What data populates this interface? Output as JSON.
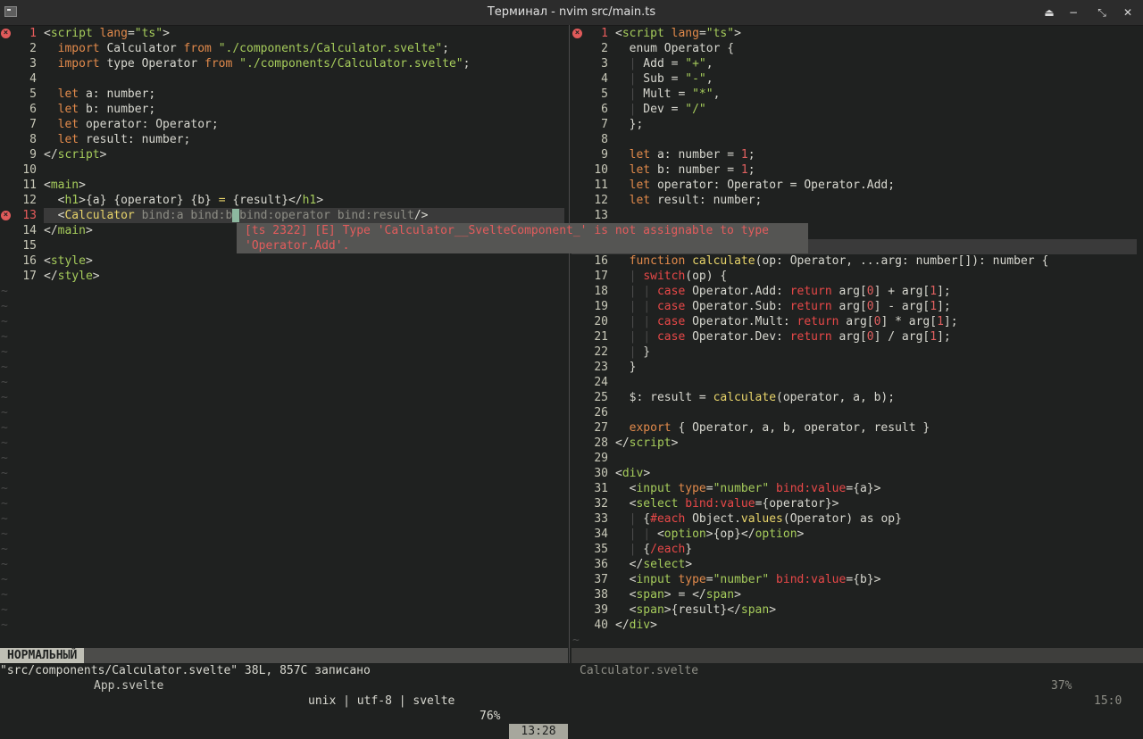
{
  "window": {
    "title": "Терминал - nvim src/main.ts",
    "buttons": [
      "keep-above",
      "minimize",
      "maximize",
      "close"
    ]
  },
  "left": {
    "filename": "App.svelte",
    "lines": [
      {
        "n": "1",
        "error": true,
        "html": "&lt;<span class='tag'>script</span><span class='k'> lang</span>=<span class='s'>\"ts\"</span>&gt;"
      },
      {
        "n": "2",
        "html": "  <span class='k'>import</span> Calculator <span class='k'>from</span> <span class='s'>\"./components/Calculator.svelte\"</span>;"
      },
      {
        "n": "3",
        "html": "  <span class='k'>import</span> type Operator <span class='k'>from</span> <span class='s'>\"./components/Calculator.svelte\"</span>;"
      },
      {
        "n": "4",
        "html": ""
      },
      {
        "n": "5",
        "html": "  <span class='k'>let</span> a: number;"
      },
      {
        "n": "6",
        "html": "  <span class='k'>let</span> b: number;"
      },
      {
        "n": "7",
        "html": "  <span class='k'>let</span> operator: Operator;"
      },
      {
        "n": "8",
        "html": "  <span class='k'>let</span> result: number;"
      },
      {
        "n": "9",
        "html": "&lt;/<span class='tag'>script</span>&gt;"
      },
      {
        "n": "10",
        "html": ""
      },
      {
        "n": "11",
        "html": "&lt;<span class='tag'>main</span>&gt;"
      },
      {
        "n": "12",
        "html": "  &lt;<span class='tag'>h1</span>&gt;{a} {operator} {b} <span class='fn'>=</span> {result}&lt;/<span class='tag'>h1</span>&gt;"
      },
      {
        "n": "13",
        "error": true,
        "cursorline": true,
        "html": "  &lt;<span class='fn'>Calculator</span><span class='dim'> bind:a bind:b</span><span style='background:#8db8a0;color:#1f2120'> </span><span class='dim'>bind:operator bind:result</span>/&gt;"
      },
      {
        "n": "14",
        "html": "&lt;/<span class='tag'>main</span>&gt;"
      },
      {
        "n": "15",
        "html": ""
      },
      {
        "n": "16",
        "html": "&lt;<span class='tag'>style</span>&gt;"
      },
      {
        "n": "17",
        "html": "&lt;/<span class='tag'>style</span>&gt;"
      }
    ],
    "tilde_count": 23,
    "status": {
      "mode": "НОРМАЛЬНЫЙ",
      "filename": "App.svelte",
      "format": "unix | utf-8 | svelte",
      "percent": "76%",
      "position": "13:28"
    }
  },
  "diagnostic": {
    "line1": "[ts 2322] [E] Type 'Calculator__SvelteComponent_' is not assignable to type",
    "line2": "'Operator.Add'."
  },
  "right": {
    "filename": "Calculator.svelte",
    "lines": [
      {
        "n": "1",
        "error": true,
        "html": "&lt;<span class='tag'>script</span><span class='k'> lang</span>=<span class='s'>\"ts\"</span>&gt;"
      },
      {
        "n": "2",
        "html": "  enum Operator {"
      },
      {
        "n": "3",
        "html": "  <span class='tilde'>|</span> Add = <span class='s'>\"+\"</span>,"
      },
      {
        "n": "4",
        "html": "  <span class='tilde'>|</span> Sub = <span class='s'>\"-\"</span>,"
      },
      {
        "n": "5",
        "html": "  <span class='tilde'>|</span> Mult = <span class='s'>\"*\"</span>,"
      },
      {
        "n": "6",
        "html": "  <span class='tilde'>|</span> Dev = <span class='s'>\"/\"</span>"
      },
      {
        "n": "7",
        "html": "  };"
      },
      {
        "n": "8",
        "html": ""
      },
      {
        "n": "9",
        "html": "  <span class='k'>let</span> a: number = <span class='n'>1</span>;"
      },
      {
        "n": "10",
        "html": "  <span class='k'>let</span> b: number = <span class='n'>1</span>;"
      },
      {
        "n": "11",
        "html": "  <span class='k'>let</span> operator: Operator = Operator.Add;"
      },
      {
        "n": "12",
        "html": "  <span class='k'>let</span> result: number;"
      },
      {
        "n": "13",
        "html": ""
      },
      {
        "n": "14",
        "html": ""
      },
      {
        "n": "15",
        "html": ""
      },
      {
        "n": "16",
        "html": "  <span class='k'>function</span> <span class='fn'>calculate</span>(op: Operator, ...arg: number[]): number {"
      },
      {
        "n": "17",
        "html": "  <span class='tilde'>|</span> <span class='bl'>switch</span>(op) {"
      },
      {
        "n": "18",
        "html": "  <span class='tilde'>|</span> <span class='tilde'>|</span> <span class='bl'>case</span> Operator.Add: <span class='bl'>return</span> arg[<span class='n'>0</span>] + arg[<span class='n'>1</span>];"
      },
      {
        "n": "19",
        "html": "  <span class='tilde'>|</span> <span class='tilde'>|</span> <span class='bl'>case</span> Operator.Sub: <span class='bl'>return</span> arg[<span class='n'>0</span>] - arg[<span class='n'>1</span>];"
      },
      {
        "n": "20",
        "html": "  <span class='tilde'>|</span> <span class='tilde'>|</span> <span class='bl'>case</span> Operator.Mult: <span class='bl'>return</span> arg[<span class='n'>0</span>] * arg[<span class='n'>1</span>];"
      },
      {
        "n": "21",
        "html": "  <span class='tilde'>|</span> <span class='tilde'>|</span> <span class='bl'>case</span> Operator.Dev: <span class='bl'>return</span> arg[<span class='n'>0</span>] / arg[<span class='n'>1</span>];"
      },
      {
        "n": "22",
        "html": "  <span class='tilde'>|</span> }"
      },
      {
        "n": "23",
        "html": "  }"
      },
      {
        "n": "24",
        "html": ""
      },
      {
        "n": "25",
        "html": "  $: result = <span class='fn'>calculate</span>(operator, a, b);"
      },
      {
        "n": "26",
        "html": ""
      },
      {
        "n": "27",
        "html": "  <span class='k'>export</span> { Operator, a, b, operator, result }"
      },
      {
        "n": "28",
        "html": "&lt;/<span class='tag'>script</span>&gt;"
      },
      {
        "n": "29",
        "html": ""
      },
      {
        "n": "30",
        "html": "&lt;<span class='tag'>div</span>&gt;"
      },
      {
        "n": "31",
        "html": "  &lt;<span class='tag'>input</span> <span class='k'>type</span>=<span class='s'>\"number\"</span> <span class='bl'>bind:value</span>={a}&gt;"
      },
      {
        "n": "32",
        "html": "  &lt;<span class='tag'>select</span> <span class='bl'>bind:value</span>={operator}&gt;"
      },
      {
        "n": "33",
        "html": "  <span class='tilde'>|</span> {<span class='bl'>#each</span> Object.<span class='fn'>values</span>(Operator) as op}"
      },
      {
        "n": "34",
        "html": "  <span class='tilde'>|</span> <span class='tilde'>|</span> &lt;<span class='tag'>option</span>&gt;{op}&lt;/<span class='tag'>option</span>&gt;"
      },
      {
        "n": "35",
        "html": "  <span class='tilde'>|</span> {<span class='bl'>/each</span>}"
      },
      {
        "n": "36",
        "html": "  &lt;/<span class='tag'>select</span>&gt;"
      },
      {
        "n": "37",
        "html": "  &lt;<span class='tag'>input</span> <span class='k'>type</span>=<span class='s'>\"number\"</span> <span class='bl'>bind:value</span>={b}&gt;"
      },
      {
        "n": "38",
        "html": "  &lt;<span class='tag'>span</span>&gt; = &lt;/<span class='tag'>span</span>&gt;"
      },
      {
        "n": "39",
        "html": "  &lt;<span class='tag'>span</span>&gt;{result}&lt;/<span class='tag'>span</span>&gt;"
      },
      {
        "n": "40",
        "html": "&lt;/<span class='tag'>div</span>&gt;"
      }
    ],
    "tilde_count": 1,
    "status": {
      "filename": "Calculator.svelte",
      "percent": "37%",
      "position": "15:0"
    }
  },
  "message": "\"src/components/Calculator.svelte\" 38L, 857C записано"
}
